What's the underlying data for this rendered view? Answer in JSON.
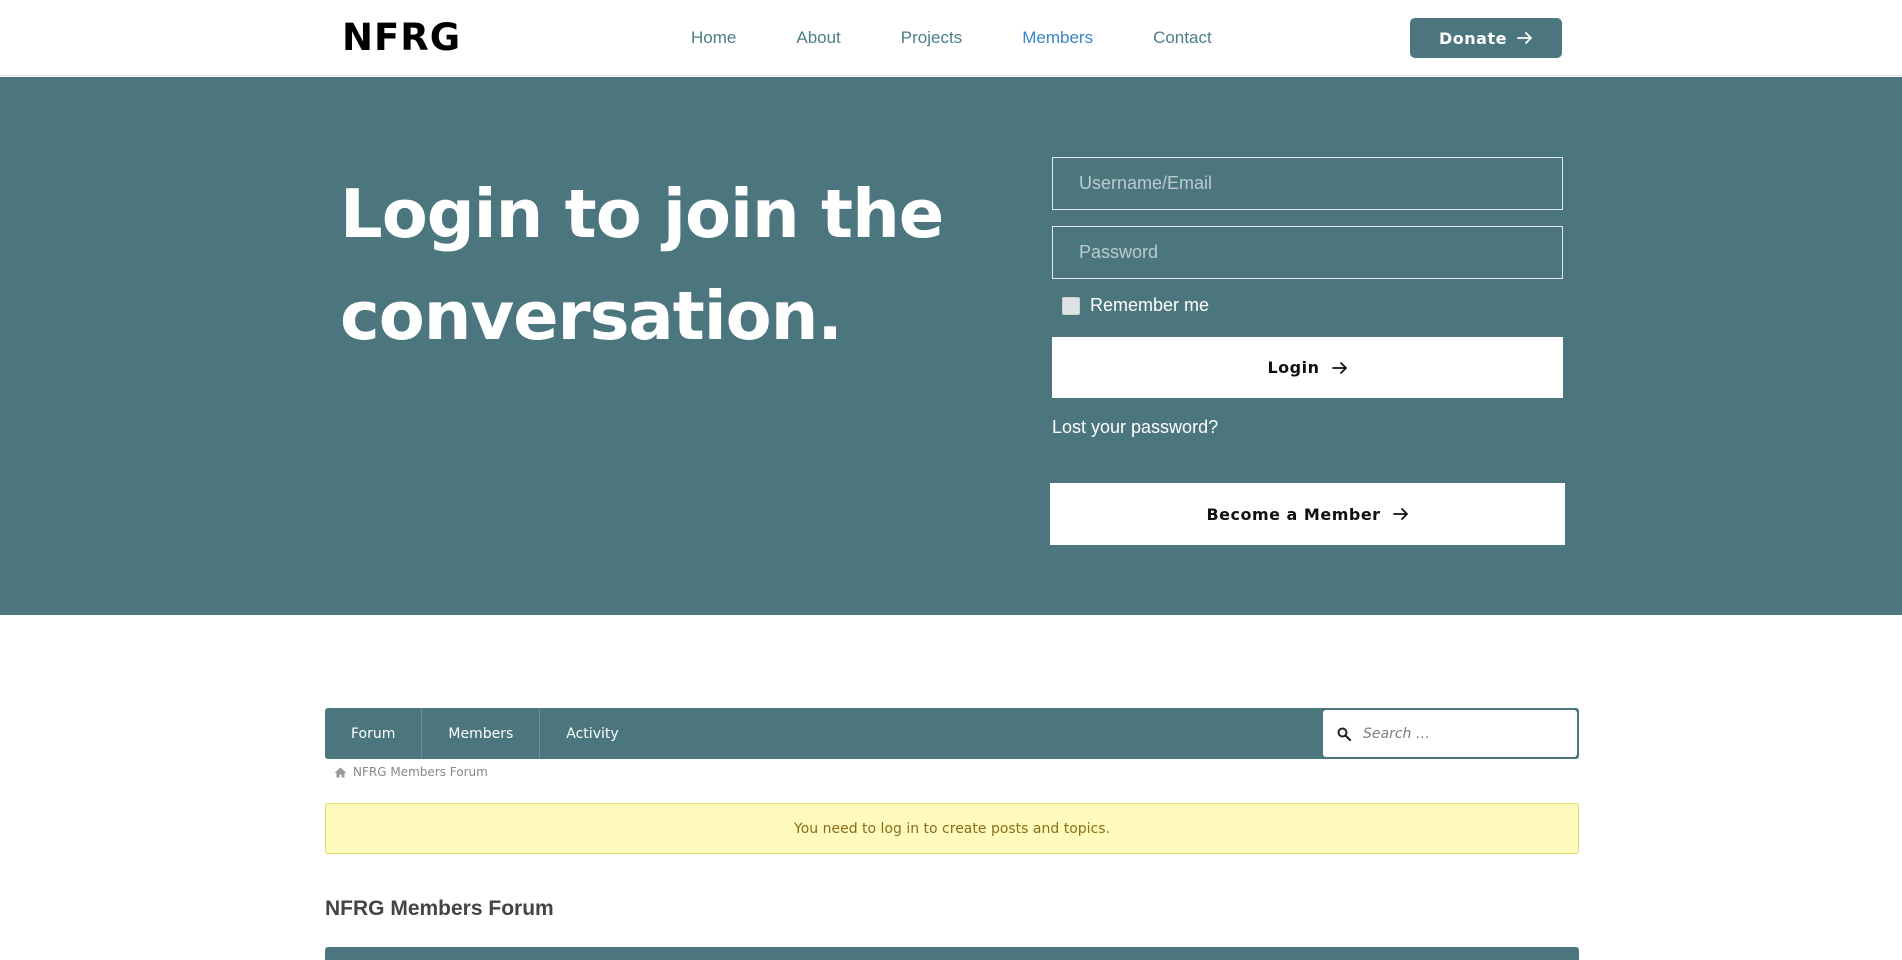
{
  "header": {
    "logo": "NFRG",
    "nav": [
      {
        "label": "Home"
      },
      {
        "label": "About"
      },
      {
        "label": "Projects"
      },
      {
        "label": "Members"
      },
      {
        "label": "Contact"
      }
    ],
    "donate_label": "Donate"
  },
  "hero": {
    "title": "Login to join the conversation.",
    "username_placeholder": "Username/Email",
    "password_placeholder": "Password",
    "remember_label": "Remember me",
    "login_label": "Login",
    "lost_password": "Lost your password?",
    "become_member_label": "Become a Member"
  },
  "forum": {
    "tabs": [
      {
        "label": "Forum"
      },
      {
        "label": "Members"
      },
      {
        "label": "Activity"
      }
    ],
    "search_placeholder": "Search …",
    "breadcrumb": "NFRG Members Forum",
    "notice": "You need to log in to create posts and topics.",
    "title": "NFRG Members Forum"
  },
  "colors": {
    "primary": "#4b767d",
    "nav_link": "#4a7f87",
    "nav_active": "#3a84c9",
    "notice_bg": "#fffbbd"
  }
}
